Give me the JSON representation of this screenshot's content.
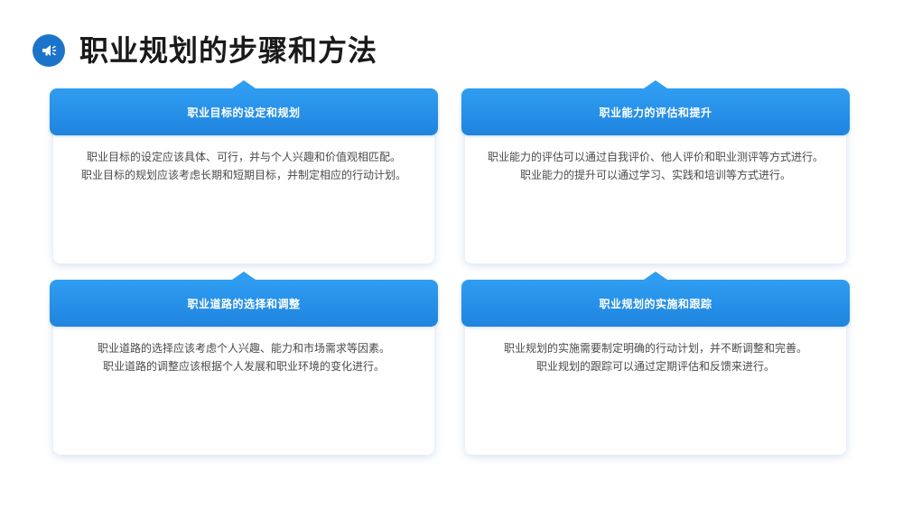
{
  "page": {
    "title": "职业规划的步骤和方法",
    "icon": "megaphone-icon",
    "accent_color": "#1b74c9",
    "header_color": "#2a93ea"
  },
  "cards": [
    {
      "title": "职业目标的设定和规划",
      "lines": [
        "职业目标的设定应该具体、可行，并与个人兴趣和价值观相匹配。",
        "职业目标的规划应该考虑长期和短期目标，并制定相应的行动计划。"
      ]
    },
    {
      "title": "职业能力的评估和提升",
      "lines": [
        "职业能力的评估可以通过自我评价、他人评价和职业测评等方式进行。",
        "职业能力的提升可以通过学习、实践和培训等方式进行。"
      ]
    },
    {
      "title": "职业道路的选择和调整",
      "lines": [
        "职业道路的选择应该考虑个人兴趣、能力和市场需求等因素。",
        "职业道路的调整应该根据个人发展和职业环境的变化进行。"
      ]
    },
    {
      "title": "职业规划的实施和跟踪",
      "lines": [
        "职业规划的实施需要制定明确的行动计划，并不断调整和完善。",
        "职业规划的跟踪可以通过定期评估和反馈来进行。"
      ]
    }
  ]
}
